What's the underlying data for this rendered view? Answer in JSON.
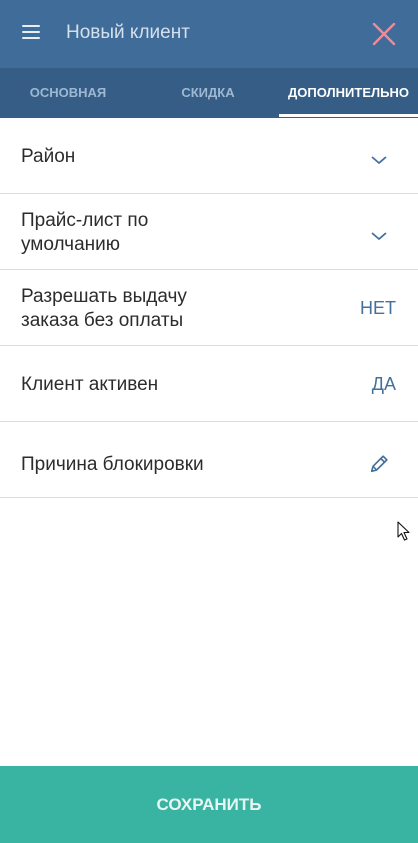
{
  "header": {
    "title": "Новый клиент",
    "menu_icon": "hamburger-menu-icon",
    "close_icon": "close-icon"
  },
  "tabs": [
    {
      "label": "ОСНОВНАЯ",
      "active": false
    },
    {
      "label": "СКИДКА",
      "active": false
    },
    {
      "label": "ДОПОЛНИТЕЛЬНО",
      "active": true
    }
  ],
  "fields": {
    "district": {
      "label": "Район",
      "control": "chevron-down-icon"
    },
    "price_list": {
      "label_line1": "Прайс-лист по",
      "label_line2": "умолчанию",
      "control": "chevron-down-icon"
    },
    "allow_unpaid": {
      "label_line1": "Разрешать выдачу",
      "label_line2": "заказа без оплаты",
      "value": "НЕТ"
    },
    "client_active": {
      "label": "Клиент активен",
      "value": "ДА"
    },
    "block_reason": {
      "label": "Причина блокировки",
      "control": "pencil-icon"
    }
  },
  "footer": {
    "save_label": "СОХРАНИТЬ"
  },
  "colors": {
    "header_bg": "#3f6c98",
    "tabs_bg": "#355d85",
    "accent_text": "#44709c",
    "save_bg": "#3ab4a2"
  }
}
